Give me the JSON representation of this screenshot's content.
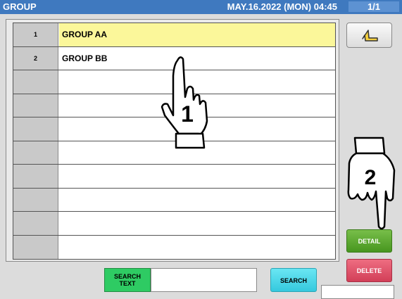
{
  "header": {
    "title": "GROUP",
    "datetime": "MAY.16.2022 (MON)  04:45",
    "page": "1/1"
  },
  "groups": [
    {
      "num": "1",
      "name": "GROUP AA"
    },
    {
      "num": "2",
      "name": "GROUP BB"
    },
    {
      "num": "",
      "name": ""
    },
    {
      "num": "",
      "name": ""
    },
    {
      "num": "",
      "name": ""
    },
    {
      "num": "",
      "name": ""
    },
    {
      "num": "",
      "name": ""
    },
    {
      "num": "",
      "name": ""
    },
    {
      "num": "",
      "name": ""
    },
    {
      "num": "",
      "name": ""
    }
  ],
  "buttons": {
    "detail": "DETAIL",
    "delete": "DELETE",
    "search": "SEARCH",
    "search_text_line1": "SEARCH",
    "search_text_line2": "TEXT"
  },
  "annotations": {
    "step1": "1",
    "step2": "2"
  },
  "icons": {
    "back": "return-arrow-icon",
    "hand": "pointing-hand-icon"
  },
  "colors": {
    "header": "#3f79bf",
    "selected_row": "#fbf79a",
    "detail": "#56a52b",
    "delete": "#e04f67",
    "search_label": "#2ecb63",
    "search_button": "#49d6e8"
  }
}
